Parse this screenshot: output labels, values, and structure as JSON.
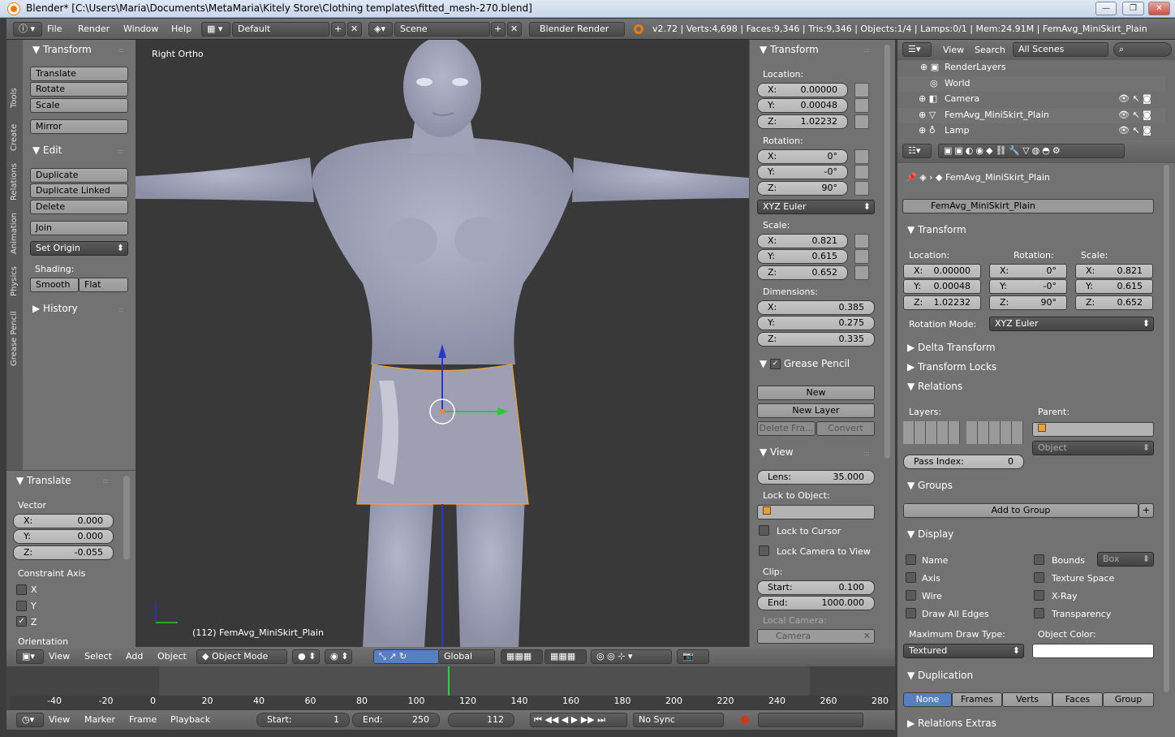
{
  "window": {
    "title": "Blender* [C:\\Users\\Maria\\Documents\\MetaMaria\\Kitely Store\\Clothing templates\\fitted_mesh-270.blend]",
    "min": "—",
    "max": "❐",
    "close": "✕"
  },
  "info": {
    "menus": [
      "File",
      "Render",
      "Window",
      "Help"
    ],
    "layout": "Default",
    "scene": "Scene",
    "engine": "Blender Render",
    "stats": "v2.72 | Verts:4,698 | Faces:9,346 | Tris:9,346 | Objects:1/4 | Lamps:0/1 | Mem:24.91M | FemAvg_MiniSkirt_Plain"
  },
  "tools": {
    "tabs": [
      "Tools",
      "Create",
      "Relations",
      "Animation",
      "Physics",
      "Grease Pencil"
    ],
    "transform_title": "Transform",
    "translate": "Translate",
    "rotate": "Rotate",
    "scale": "Scale",
    "mirror": "Mirror",
    "edit_title": "Edit",
    "duplicate": "Duplicate",
    "duplicate_linked": "Duplicate Linked",
    "delete": "Delete",
    "join": "Join",
    "set_origin": "Set Origin",
    "shading_label": "Shading:",
    "smooth": "Smooth",
    "flat": "Flat",
    "history_title": "History"
  },
  "operator": {
    "title": "Translate",
    "vector_label": "Vector",
    "x": "0.000",
    "y": "0.000",
    "z": "-0.055",
    "constraint_label": "Constraint Axis",
    "axes": [
      "X",
      "Y",
      "Z"
    ],
    "orientation": "Orientation"
  },
  "viewport": {
    "view_name": "Right Ortho",
    "object_label": "(112) FemAvg_MiniSkirt_Plain"
  },
  "npanel": {
    "transform_title": "Transform",
    "location_label": "Location:",
    "loc": [
      "0.00000",
      "0.00048",
      "1.02232"
    ],
    "rotation_label": "Rotation:",
    "rot": [
      "0°",
      "-0°",
      "90°"
    ],
    "rotation_mode": "XYZ Euler",
    "scale_label": "Scale:",
    "scale": [
      "0.821",
      "0.615",
      "0.652"
    ],
    "dimensions_label": "Dimensions:",
    "dim": [
      "0.385",
      "0.275",
      "0.335"
    ],
    "grease_title": "Grease Pencil",
    "gp_new": "New",
    "gp_new_layer": "New Layer",
    "gp_delete": "Delete Fra...",
    "gp_convert": "Convert",
    "view_title": "View",
    "lens_label": "Lens:",
    "lens": "35.000",
    "lock_obj_label": "Lock to Object:",
    "lock_cursor": "Lock to Cursor",
    "lock_cam": "Lock Camera to View",
    "clip_label": "Clip:",
    "clip_start_k": "Start:",
    "clip_start": "0.100",
    "clip_end_k": "End:",
    "clip_end": "1000.000",
    "local_camera": "Local Camera:",
    "camera": "Camera"
  },
  "outliner": {
    "view": "View",
    "search": "Search",
    "scenes": "All Scenes",
    "items": [
      "RenderLayers",
      "World",
      "Camera",
      "FemAvg_MiniSkirt_Plain",
      "Lamp"
    ]
  },
  "props": {
    "object_name": "FemAvg_MiniSkirt_Plain",
    "breadcrumb": "FemAvg_MiniSkirt_Plain",
    "transform_title": "Transform",
    "location_label": "Location:",
    "rotation_label": "Rotation:",
    "scale_label": "Scale:",
    "rotation_mode_label": "Rotation Mode:",
    "rotation_mode": "XYZ Euler",
    "delta": "Delta Transform",
    "locks": "Transform Locks",
    "relations": "Relations",
    "layers_label": "Layers:",
    "parent_label": "Parent:",
    "parent_type": "Object",
    "pass_index_label": "Pass Index:",
    "pass_index": "0",
    "groups": "Groups",
    "add_group": "Add to Group",
    "display": "Display",
    "name": "Name",
    "axis": "Axis",
    "wire": "Wire",
    "draw_all_edges": "Draw All Edges",
    "bounds": "Bounds",
    "bounds_type": "Box",
    "texture_space": "Texture Space",
    "xray": "X-Ray",
    "transparency": "Transparency",
    "max_draw_label": "Maximum Draw Type:",
    "max_draw": "Textured",
    "object_color_label": "Object Color:",
    "duplication": "Duplication",
    "dup_options": [
      "None",
      "Frames",
      "Verts",
      "Faces",
      "Group"
    ],
    "relations_extras": "Relations Extras"
  },
  "view3d_header": {
    "menus": [
      "View",
      "Select",
      "Add",
      "Object"
    ],
    "mode": "Object Mode",
    "orientation": "Global"
  },
  "timeline": {
    "ticks": [
      "-40",
      "-20",
      "0",
      "20",
      "40",
      "60",
      "80",
      "100",
      "120",
      "140",
      "160",
      "180",
      "200",
      "220",
      "240",
      "260",
      "280"
    ],
    "menus": [
      "View",
      "Marker",
      "Frame",
      "Playback"
    ],
    "start_k": "Start:",
    "start": "1",
    "end_k": "End:",
    "end": "250",
    "current": "112",
    "sync": "No Sync"
  },
  "axes": {
    "x": "X:",
    "y": "Y:",
    "z": "Z:"
  }
}
